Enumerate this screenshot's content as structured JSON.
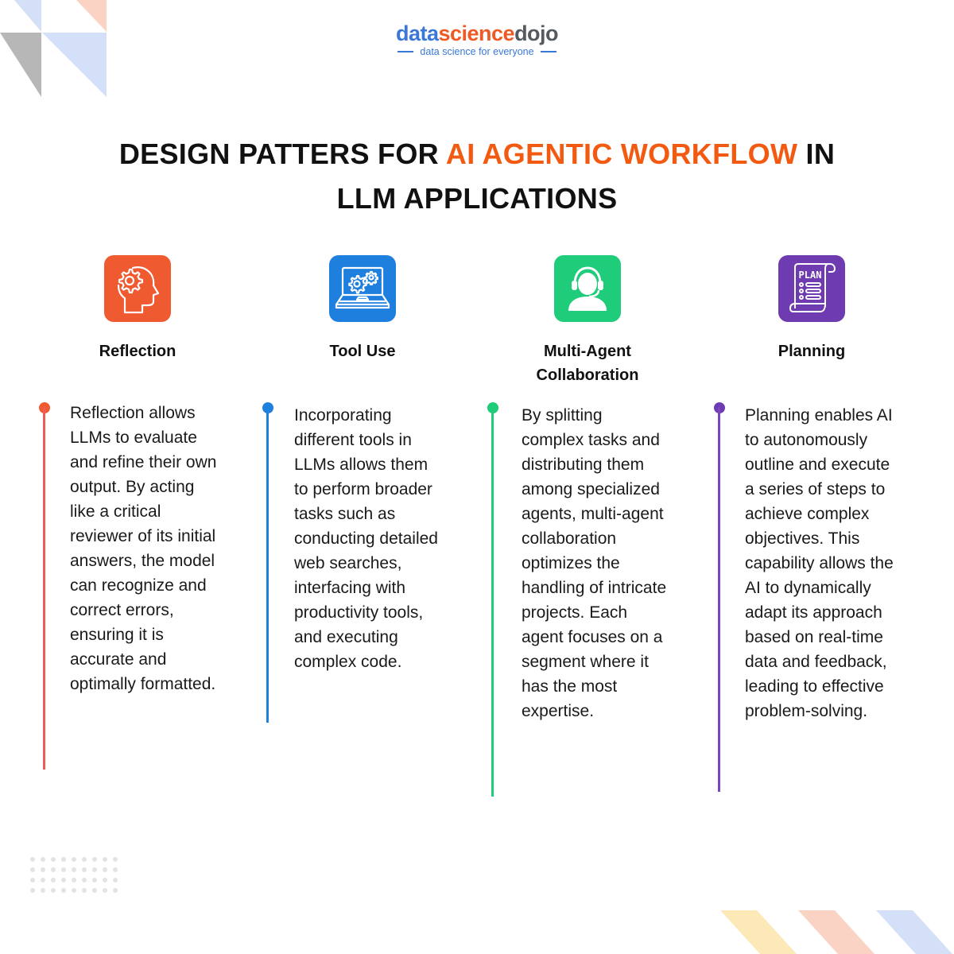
{
  "brand": {
    "logo_part1": "data",
    "logo_part2": "science",
    "logo_part3": "dojo",
    "tagline": "data science for everyone"
  },
  "title": {
    "prefix": "DESIGN PATTERS FOR ",
    "accent": "AI AGENTIC WORKFLOW",
    "suffix": " IN",
    "line2": "LLM APPLICATIONS"
  },
  "colors": {
    "reflection": "#ef5a30",
    "tool_use": "#1e7fde",
    "multi_agent": "#1fcc7a",
    "planning": "#6f3bb0",
    "title_accent": "#f25a12"
  },
  "patterns": [
    {
      "title": "Reflection",
      "icon": "head-gear-icon",
      "description": "Reflection allows LLMs to evaluate and refine their own output. By acting like a critical reviewer of its initial answers, the model can recognize and correct errors, ensuring it is accurate and optimally formatted."
    },
    {
      "title": "Tool Use",
      "icon": "laptop-gears-icon",
      "description": "Incorporating different tools in LLMs allows them to perform broader tasks such as conducting detailed web searches, interfacing with productivity tools, and executing complex code."
    },
    {
      "title": "Multi-Agent Collaboration",
      "icon": "headset-agent-icon",
      "description": "By splitting complex tasks and distributing them among specialized agents, multi-agent collaboration optimizes the handling of intricate projects. Each agent focuses on a segment where it has the most expertise."
    },
    {
      "title": "Planning",
      "icon": "plan-scroll-icon",
      "description": "Planning enables AI to autonomously outline and execute a series of steps to achieve complex objectives. This capability allows the AI to dynamically adapt its approach based on real-time data and feedback, leading to effective problem-solving."
    }
  ],
  "plan_icon_label": "PLAN"
}
